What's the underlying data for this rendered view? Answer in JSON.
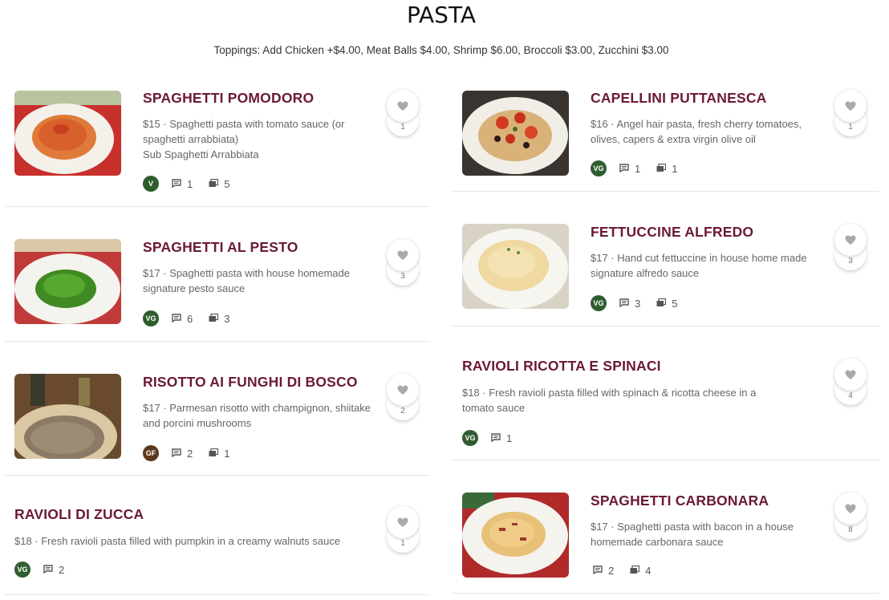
{
  "page": {
    "title": "PASTA",
    "toppings": "Toppings: Add Chicken +$4.00, Meat Balls $4.00, Shrimp $6.00, Broccoli $3.00, Zucchini $3.00"
  },
  "icons": {
    "comments": "comment-icon",
    "photos": "photo-icon",
    "favorite": "heart-icon"
  },
  "colors": {
    "item_name": "#6b1a32",
    "badge_vg": "#2f5d2f",
    "badge_gf": "#5a3a1a"
  },
  "left": [
    {
      "name": "SPAGHETTI POMODORO",
      "desc": "$15 · Spaghetti pasta with tomato sauce (or spaghetti arrabbiata)",
      "sub": "Sub Spaghetti Arrabbiata",
      "badge": "V",
      "comments": "1",
      "photos": "5",
      "likes": "1"
    },
    {
      "name": "SPAGHETTI AL PESTO",
      "desc": "$17 · Spaghetti pasta with house homemade signature pesto sauce",
      "badge": "VG",
      "comments": "6",
      "photos": "3",
      "likes": "3"
    },
    {
      "name": "RISOTTO AI FUNGHI DI BOSCO",
      "desc": "$17 · Parmesan risotto with champignon, shiitake and porcini mushrooms",
      "badge": "GF",
      "comments": "2",
      "photos": "1",
      "likes": "2"
    },
    {
      "name": "RAVIOLI DI ZUCCA",
      "desc": "$18 · Fresh ravioli pasta filled with pumpkin in a creamy walnuts sauce",
      "badge": "VG",
      "comments": "2",
      "likes": "1"
    }
  ],
  "right": [
    {
      "name": "CAPELLINI PUTTANESCA",
      "desc": "$16 · Angel hair pasta, fresh cherry tomatoes, olives, capers & extra virgin olive oil",
      "badge": "VG",
      "comments": "1",
      "photos": "1",
      "likes": "1"
    },
    {
      "name": "FETTUCCINE ALFREDO",
      "desc": "$17 · Hand cut fettuccine in house home made signature alfredo sauce",
      "badge": "VG",
      "comments": "3",
      "photos": "5",
      "likes": "3"
    },
    {
      "name": "RAVIOLI RICOTTA E SPINACI",
      "desc": "$18 · Fresh ravioli pasta filled with spinach & ricotta cheese in a tomato sauce",
      "badge": "VG",
      "comments": "1",
      "likes": "4"
    },
    {
      "name": "SPAGHETTI CARBONARA",
      "desc": "$17 · Spaghetti pasta with bacon in a house homemade carbonara sauce",
      "comments": "2",
      "photos": "4",
      "likes": "8"
    }
  ]
}
